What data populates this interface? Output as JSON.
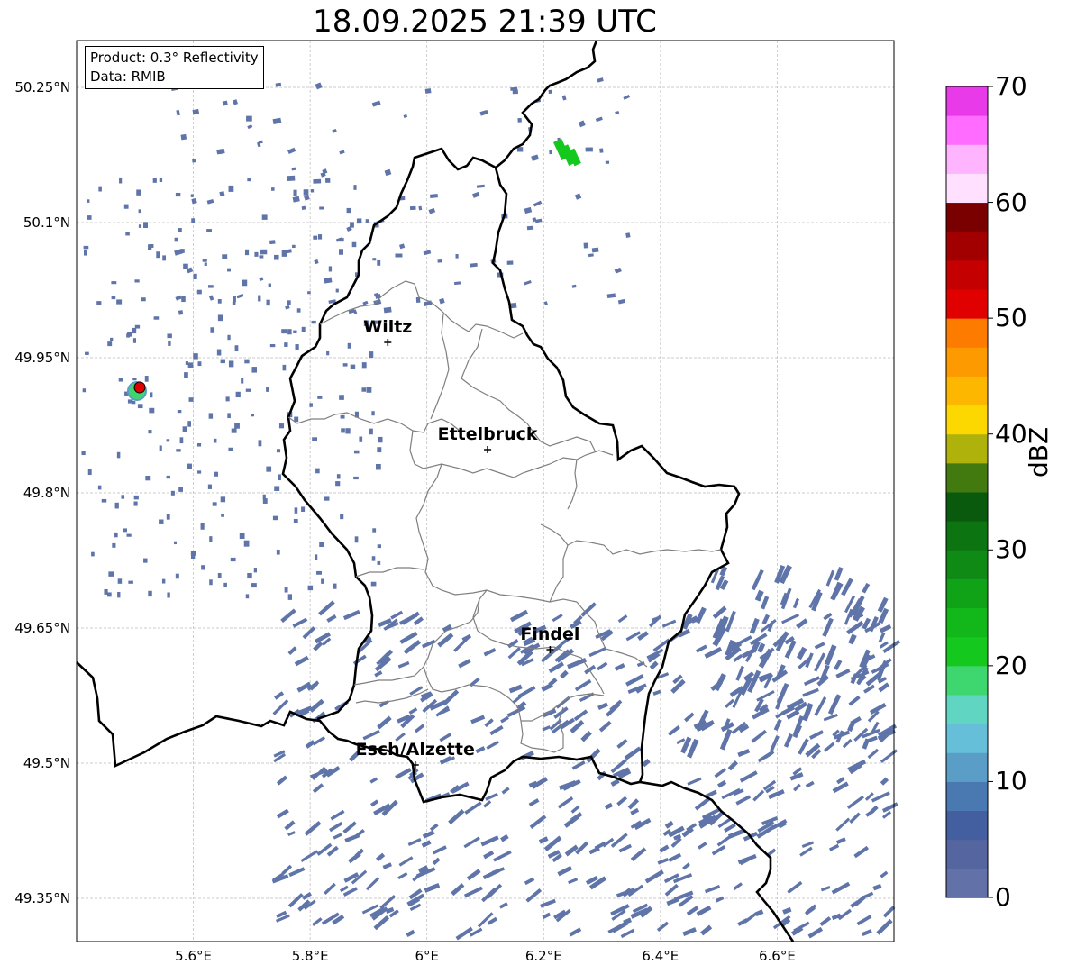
{
  "title": "18.09.2025 21:39 UTC",
  "info": {
    "product": "Product: 0.3° Reflectivity",
    "data": "Data: RMIB"
  },
  "map": {
    "lat_labels": [
      "50.25°N",
      "50.1°N",
      "49.95°N",
      "49.8°N",
      "49.65°N",
      "49.5°N",
      "49.35°N"
    ],
    "lon_labels": [
      "5.6°E",
      "5.8°E",
      "6°E",
      "6.2°E",
      "6.4°E",
      "6.6°E"
    ],
    "lat_range": [
      49.302,
      50.302
    ],
    "lon_range": [
      5.4,
      6.8
    ],
    "grid": true,
    "cities": [
      {
        "name": "Wiltz",
        "lon": 5.933,
        "lat": 49.967
      },
      {
        "name": "Ettelbruck",
        "lon": 6.104,
        "lat": 49.848
      },
      {
        "name": "Findel",
        "lon": 6.211,
        "lat": 49.626
      },
      {
        "name": "Esch/Alzette",
        "lon": 5.98,
        "lat": 49.498
      }
    ],
    "radar_site": {
      "lon": 5.505,
      "lat": 49.914
    },
    "country_border_color": "#000000",
    "canton_border_color": "#808080",
    "echo_color": "#5f74a8"
  },
  "colorbar": {
    "label": "dBZ",
    "ticks": [
      "0",
      "10",
      "20",
      "30",
      "40",
      "50",
      "60",
      "70"
    ],
    "min": 0,
    "max": 70,
    "step": 2.5,
    "colors": [
      "#6272a8",
      "#5565a0",
      "#445f9f",
      "#4a78b0",
      "#5a9ec8",
      "#65bfd8",
      "#60d6c2",
      "#3ed66e",
      "#15c81e",
      "#12b81a",
      "#10a318",
      "#0e8a15",
      "#0c7512",
      "#0a5a0e",
      "#427a10",
      "#aeb20a",
      "#fdd700",
      "#fdb700",
      "#fd9a00",
      "#fd7c00",
      "#e00000",
      "#c40000",
      "#a20000",
      "#7a0000",
      "#ffe0ff",
      "#ffb4ff",
      "#ff6cff",
      "#e93ae9"
    ]
  }
}
